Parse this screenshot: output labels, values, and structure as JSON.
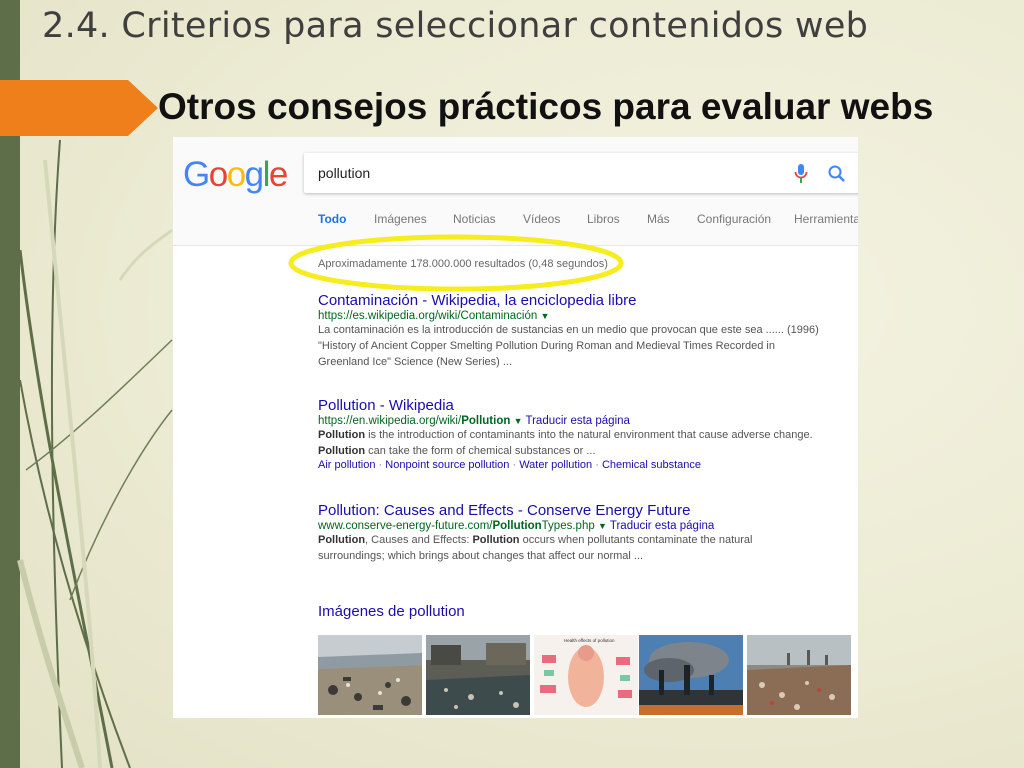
{
  "slide": {
    "title": "2.4. Criterios para seleccionar contenidos web",
    "subtitle": "Otros consejos prácticos para evaluar webs",
    "accent_color": "#ee7f1a",
    "sidebar_color": "#5e6e49"
  },
  "google": {
    "logo_text": "Google",
    "search_value": "pollution",
    "tabs": [
      "Todo",
      "Imágenes",
      "Noticias",
      "Vídeos",
      "Libros",
      "Más",
      "Configuración",
      "Herramienta"
    ],
    "active_tab": "Todo",
    "stats": "Aproximadamente 178.000.000 resultados (0,48 segundos)",
    "highlight_color": "#f7ec1e",
    "results": [
      {
        "title": "Contaminación - Wikipedia, la enciclopedia libre",
        "url": "https://es.wikipedia.org/wiki/Contaminación",
        "translate": "",
        "snippet_lines": [
          "La contaminación es la introducción de sustancias en un medio que provocan que este sea ...... (1996)",
          "\"History of Ancient Copper Smelting Pollution During Roman and Medieval Times Recorded in",
          "Greenland Ice\" Science (New Series) ..."
        ]
      },
      {
        "title": "Pollution - Wikipedia",
        "url_prefix": "https://en.wikipedia.org/wiki/",
        "url_bold": "Pollution",
        "translate": "Traducir esta página",
        "snippet_lines": [
          "is the introduction of contaminants into the natural environment that cause adverse change.",
          "can take the form of chemical substances or ..."
        ],
        "snippet_bold": "Pollution",
        "sublinks": [
          "Air pollution",
          "Nonpoint source pollution",
          "Water pollution",
          "Chemical substance"
        ]
      },
      {
        "title": "Pollution: Causes and Effects - Conserve Energy Future",
        "url_prefix": "www.conserve-energy-future.com/",
        "url_bold": "Pollution",
        "url_suffix": "Types.php",
        "translate": "Traducir esta página",
        "snippet_bold_1": "Pollution",
        "snippet_mid": ", Causes and Effects: ",
        "snippet_bold_2": "Pollution",
        "snippet_rest": " occurs when pollutants contaminate the natural",
        "snippet_line2": "surroundings; which brings about changes that affect our normal ..."
      }
    ],
    "images_heading": "Imágenes de pollution",
    "image_thumbs": [
      "beach-litter-photo",
      "polluted-water-photo",
      "health-effects-diagram",
      "smokestacks-photo",
      "landfill-photo"
    ],
    "diagram_caption": "Health effects of pollution"
  }
}
